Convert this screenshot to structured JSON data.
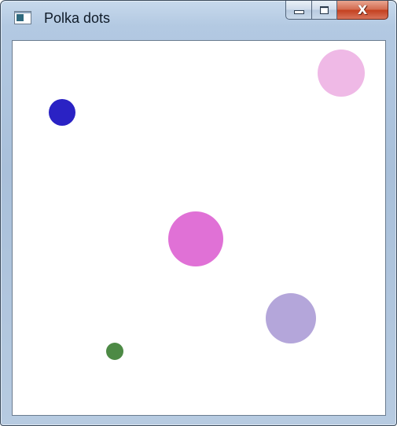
{
  "window": {
    "title": "Polka dots",
    "icon": "application-window-icon",
    "buttons": {
      "minimize": "minimize-icon",
      "maximize": "maximize-icon",
      "close": "close-icon"
    }
  },
  "canvas": {
    "background": "#ffffff",
    "dots": [
      {
        "name": "navy-dot",
        "color": "#2a22c4"
      },
      {
        "name": "light-pink-dot",
        "color": "#efb9e6"
      },
      {
        "name": "magenta-dot",
        "color": "#e071d6"
      },
      {
        "name": "lavender-dot",
        "color": "#b4a6da"
      },
      {
        "name": "green-dot",
        "color": "#4d8a45"
      }
    ]
  }
}
